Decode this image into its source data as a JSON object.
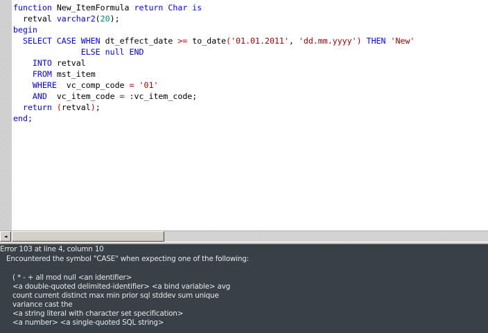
{
  "code_lines": [
    [
      {
        "t": "function ",
        "c": "kw"
      },
      {
        "t": "New_ItemFormula ",
        "c": "id"
      },
      {
        "t": "return ",
        "c": "kw"
      },
      {
        "t": "Char ",
        "c": "kw"
      },
      {
        "t": "is",
        "c": "kw"
      }
    ],
    [
      {
        "t": "  retval ",
        "c": "id"
      },
      {
        "t": "varchar2",
        "c": "kw"
      },
      {
        "t": "(",
        "c": "id"
      },
      {
        "t": "20",
        "c": "num"
      },
      {
        "t": ");",
        "c": "id"
      }
    ],
    [
      {
        "t": "begin",
        "c": "kw"
      }
    ],
    [
      {
        "t": "  SELECT CASE WHEN ",
        "c": "kw"
      },
      {
        "t": "dt_effect_date ",
        "c": "id"
      },
      {
        "t": ">=",
        "c": "op"
      },
      {
        "t": " to_date",
        "c": "id"
      },
      {
        "t": "(",
        "c": "op"
      },
      {
        "t": "'01.01.2011'",
        "c": "str"
      },
      {
        "t": ", ",
        "c": "id"
      },
      {
        "t": "'dd.mm.yyyy'",
        "c": "str"
      },
      {
        "t": ")",
        "c": "op"
      },
      {
        "t": " THEN ",
        "c": "kw"
      },
      {
        "t": "'New'",
        "c": "str"
      }
    ],
    [
      {
        "t": "              ELSE null END",
        "c": "kw"
      }
    ],
    [
      {
        "t": "    INTO ",
        "c": "kw"
      },
      {
        "t": "retval",
        "c": "id"
      }
    ],
    [
      {
        "t": "    FROM ",
        "c": "kw"
      },
      {
        "t": "mst_item",
        "c": "id"
      }
    ],
    [
      {
        "t": "    WHERE  ",
        "c": "kw"
      },
      {
        "t": "vc_comp_code ",
        "c": "id"
      },
      {
        "t": "=",
        "c": "op"
      },
      {
        "t": " ",
        "c": "id"
      },
      {
        "t": "'01'",
        "c": "str"
      }
    ],
    [
      {
        "t": "    AND  ",
        "c": "kw"
      },
      {
        "t": "vc_item_code ",
        "c": "id"
      },
      {
        "t": "=",
        "c": "op"
      },
      {
        "t": " :vc_item_code;",
        "c": "id"
      }
    ],
    [
      {
        "t": "  return ",
        "c": "kw"
      },
      {
        "t": "(",
        "c": "op"
      },
      {
        "t": "retval",
        "c": "id"
      },
      {
        "t": ")",
        "c": "op"
      },
      {
        "t": ";",
        "c": "id"
      }
    ],
    [
      {
        "t": "end;",
        "c": "kw"
      }
    ]
  ],
  "error": {
    "header": "Error 103 at line 4, column 10",
    "message": "Encountered the symbol \"CASE\" when expecting one of the following:",
    "expected": [
      "( * - + all mod null <an identifier>",
      "<a double-quoted delimited-identifier> <a bind variable> avg",
      "count current distinct max min prior sql stddev sum unique",
      "variance cast the",
      "<a string literal with character set specification>",
      "<a number> <a single-quoted SQL string>"
    ]
  },
  "scrollbar": {
    "left_arrow": "◄"
  }
}
